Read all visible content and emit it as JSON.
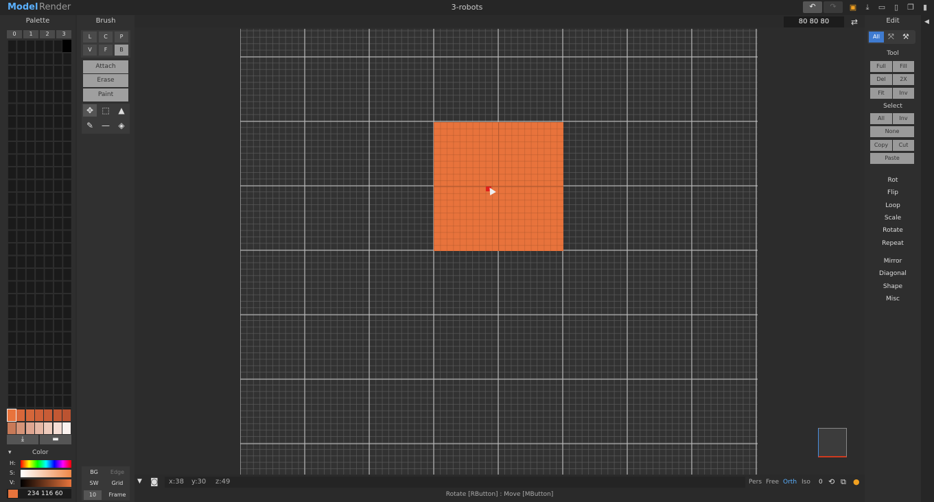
{
  "topbar": {
    "modes": [
      "Model",
      "Render"
    ],
    "title": "3-robots"
  },
  "palette": {
    "header": "Palette",
    "tabs": [
      "0",
      "1",
      "2",
      "3"
    ],
    "swatch_row1": [
      "#e8733c",
      "#d8673a",
      "#d4663a",
      "#cf6038",
      "#c85c36",
      "#c25833",
      "#bb5331"
    ],
    "swatch_row2": [
      "#c87a58",
      "#d69478",
      "#dfa590",
      "#e6b7a5",
      "#eecbbd",
      "#f4ddd5",
      "#fbf2ef"
    ],
    "color_label": "Color",
    "h_label": "H:",
    "s_label": "S:",
    "v_label": "V:",
    "rgb": "234  116  60",
    "current_color": "#e8743c"
  },
  "brush": {
    "header": "Brush",
    "row1": [
      "L",
      "C",
      "P"
    ],
    "row2": [
      "V",
      "F",
      "B"
    ],
    "modes": [
      "Attach",
      "Erase",
      "Paint"
    ],
    "bottom": {
      "bg": "BG",
      "edge": "Edge",
      "sw": "SW",
      "grid": "Grid",
      "size": "10",
      "frame": "Frame"
    }
  },
  "edit": {
    "header": "Edit",
    "tabs": [
      "All"
    ],
    "tool_head": "Tool",
    "tool_buttons": [
      "Full",
      "Fill",
      "Del",
      "2X",
      "Fit",
      "Inv"
    ],
    "select_head": "Select",
    "select_buttons": [
      "All",
      "Inv",
      "None",
      "Copy",
      "Cut",
      "Paste"
    ],
    "items1": [
      "Rot",
      "Flip",
      "Loop",
      "Scale",
      "Rotate",
      "Repeat"
    ],
    "items2": [
      "Mirror",
      "Diagonal",
      "Shape",
      "Misc"
    ]
  },
  "viewport": {
    "size_display": "80  80  80",
    "coords": {
      "x": "x:38",
      "y": "y:30",
      "z": "z:49"
    },
    "views": [
      "Pers",
      "Free",
      "Orth",
      "Iso"
    ],
    "active_view": "Orth",
    "zero": "0",
    "hint": "Rotate [RButton] : Move [MButton]"
  }
}
